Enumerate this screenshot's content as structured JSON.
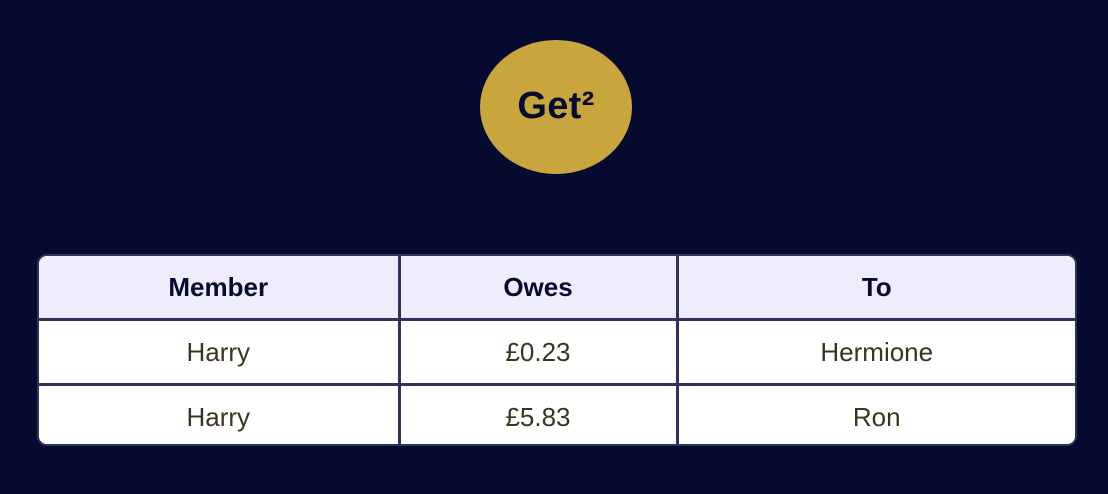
{
  "logo": {
    "text": "Get²"
  },
  "table": {
    "headers": [
      "Member",
      "Owes",
      "To"
    ],
    "rows": [
      {
        "member": "Harry",
        "owes": "£0.23",
        "to": "Hermione"
      },
      {
        "member": "Harry",
        "owes": "£5.83",
        "to": "Ron"
      }
    ]
  },
  "colors": {
    "background": "#060a2e",
    "logo_fill": "#c8a63d",
    "header_fill": "#eeecfd",
    "border": "#2f3359"
  }
}
